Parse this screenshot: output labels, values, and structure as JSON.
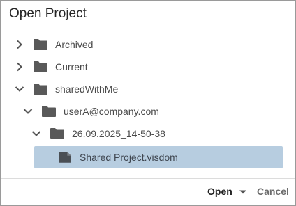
{
  "dialog": {
    "title": "Open Project"
  },
  "tree": [
    {
      "label": "Archived",
      "expanded": false,
      "type": "folder",
      "icon": "folder-icon",
      "chevron": "chevron-right-icon"
    },
    {
      "label": "Current",
      "expanded": false,
      "type": "folder",
      "icon": "folder-icon",
      "chevron": "chevron-right-icon"
    },
    {
      "label": "sharedWithMe",
      "expanded": true,
      "type": "folder",
      "icon": "folder-icon",
      "chevron": "chevron-down-icon"
    },
    {
      "label": "userA@company.com",
      "expanded": true,
      "type": "folder",
      "icon": "folder-icon",
      "chevron": "chevron-down-icon"
    },
    {
      "label": "26.09.2025_14-50-38",
      "expanded": true,
      "type": "folder",
      "icon": "folder-icon",
      "chevron": "chevron-down-icon"
    },
    {
      "label": "Shared Project.visdom",
      "type": "file",
      "selected": true,
      "icon": "file-icon"
    }
  ],
  "footer": {
    "open_label": "Open",
    "cancel_label": "Cancel"
  },
  "colors": {
    "selection": "#b7cde0",
    "icon": "#595959"
  }
}
